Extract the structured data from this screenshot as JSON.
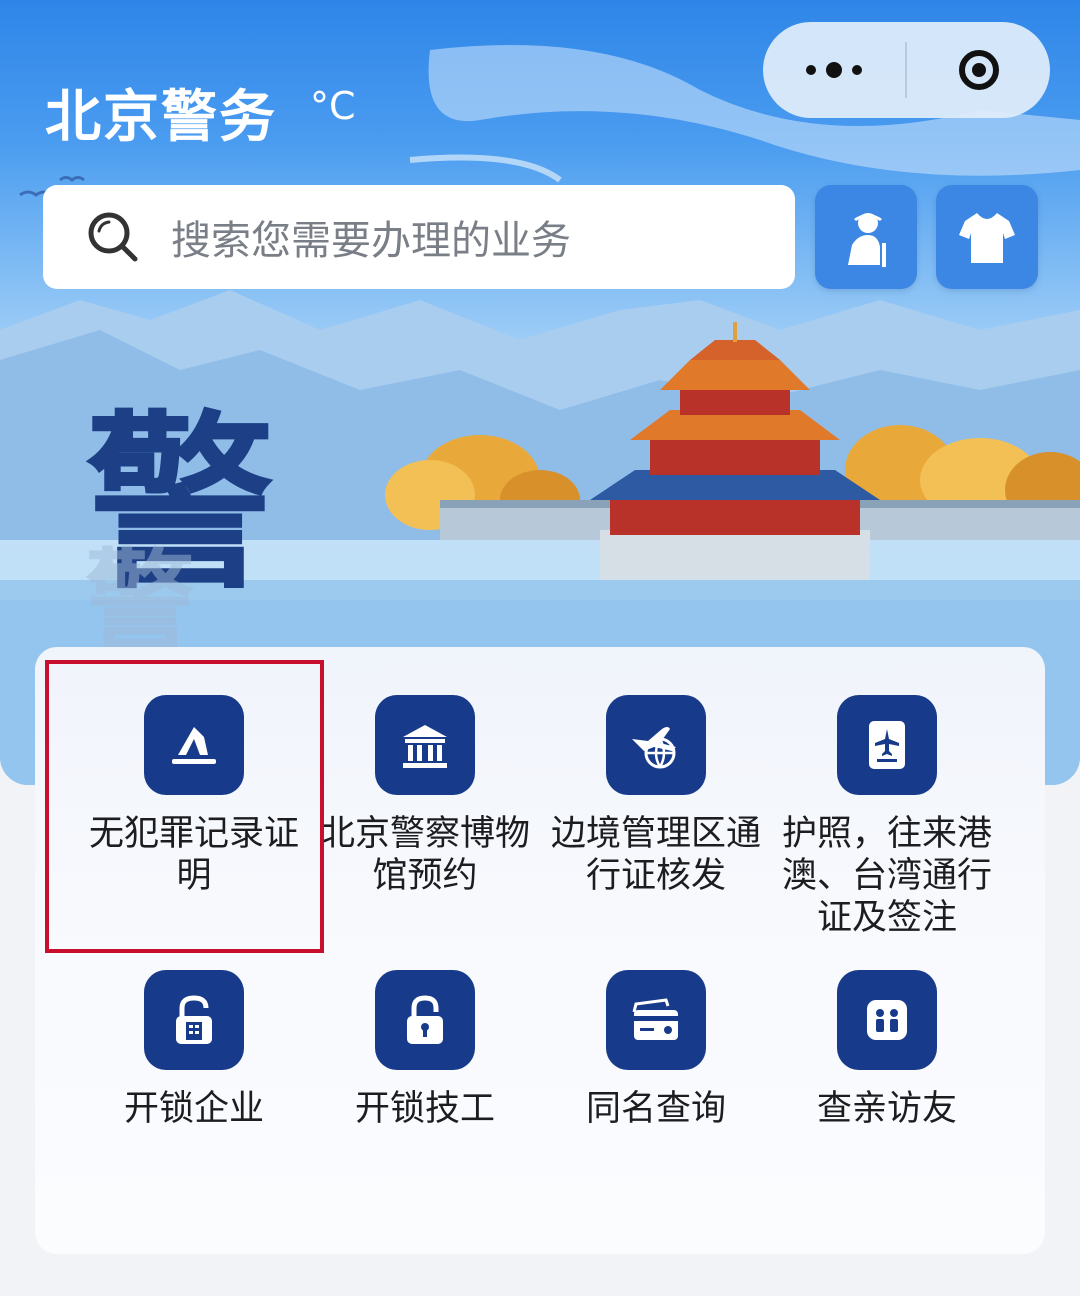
{
  "header": {
    "title": "北京警务",
    "temperature_unit": "°C"
  },
  "search": {
    "placeholder": "搜索您需要办理的业务"
  },
  "quick_buttons": [
    {
      "icon": "elder-care-icon"
    },
    {
      "icon": "shirt-icon"
    }
  ],
  "banner": {
    "emblem_char": "警"
  },
  "services": [
    {
      "label": "无犯罪记录证明",
      "icon": "document-stamp-icon"
    },
    {
      "label": "北京警察博物馆预约",
      "icon": "museum-icon"
    },
    {
      "label": "边境管理区通行证核发",
      "icon": "plane-globe-icon"
    },
    {
      "label": "护照，往来港澳、台湾通行证及签注",
      "icon": "passport-icon"
    },
    {
      "label": "开锁企业",
      "icon": "lock-building-icon"
    },
    {
      "label": "开锁技工",
      "icon": "padlock-icon"
    },
    {
      "label": "同名查询",
      "icon": "id-cards-icon"
    },
    {
      "label": "查亲访友",
      "icon": "people-icon"
    }
  ],
  "colors": {
    "tile": "#183a8a",
    "highlight": "#c8102e",
    "quick_button": "#3c87e3"
  }
}
